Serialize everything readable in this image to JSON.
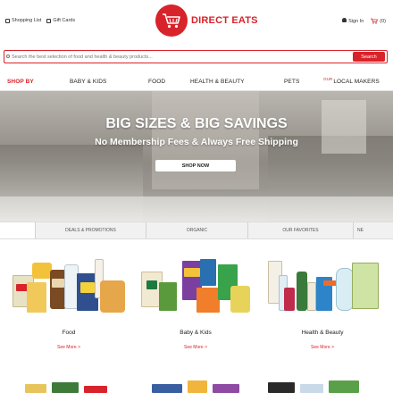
{
  "header": {
    "shopping_list": "Shopping List",
    "gift_cards": "Gift Cards",
    "logo_text": "DIRECT EATS",
    "sign_in": "Sign In",
    "cart_count": "(0)"
  },
  "search": {
    "placeholder": "Search the best selection of food and health & beauty products...",
    "button_label": "Search"
  },
  "nav": {
    "shop_by": "SHOP BY",
    "items": [
      {
        "label": "BABY & KIDS"
      },
      {
        "label": "FOOD"
      },
      {
        "label": "HEALTH & BEAUTY"
      },
      {
        "label": "PETS"
      },
      {
        "label": "LOCAL MAKERS",
        "prefix": "OUR"
      }
    ]
  },
  "hero": {
    "title": "BIG SIZES & BIG SAVINGS",
    "subtitle": "No Membership Fees & Always Free Shipping",
    "button": "SHOP NOW"
  },
  "tabs": [
    {
      "label": ""
    },
    {
      "label": "DEALS & PROMOTIONS"
    },
    {
      "label": "ORGANIC"
    },
    {
      "label": "OUR FAVORITES"
    },
    {
      "label": "NE"
    }
  ],
  "categories": [
    {
      "label": "Food",
      "more": "See More >"
    },
    {
      "label": "Baby & Kids",
      "more": "See More >"
    },
    {
      "label": "Health & Beauty",
      "more": "See More >"
    }
  ],
  "colors": {
    "brand_red": "#d8232a",
    "tab_bg": "#f1f1f1"
  },
  "icons": [
    "list-icon",
    "gift-icon",
    "cart-logo-icon",
    "user-icon",
    "cart-icon",
    "search-icon"
  ]
}
